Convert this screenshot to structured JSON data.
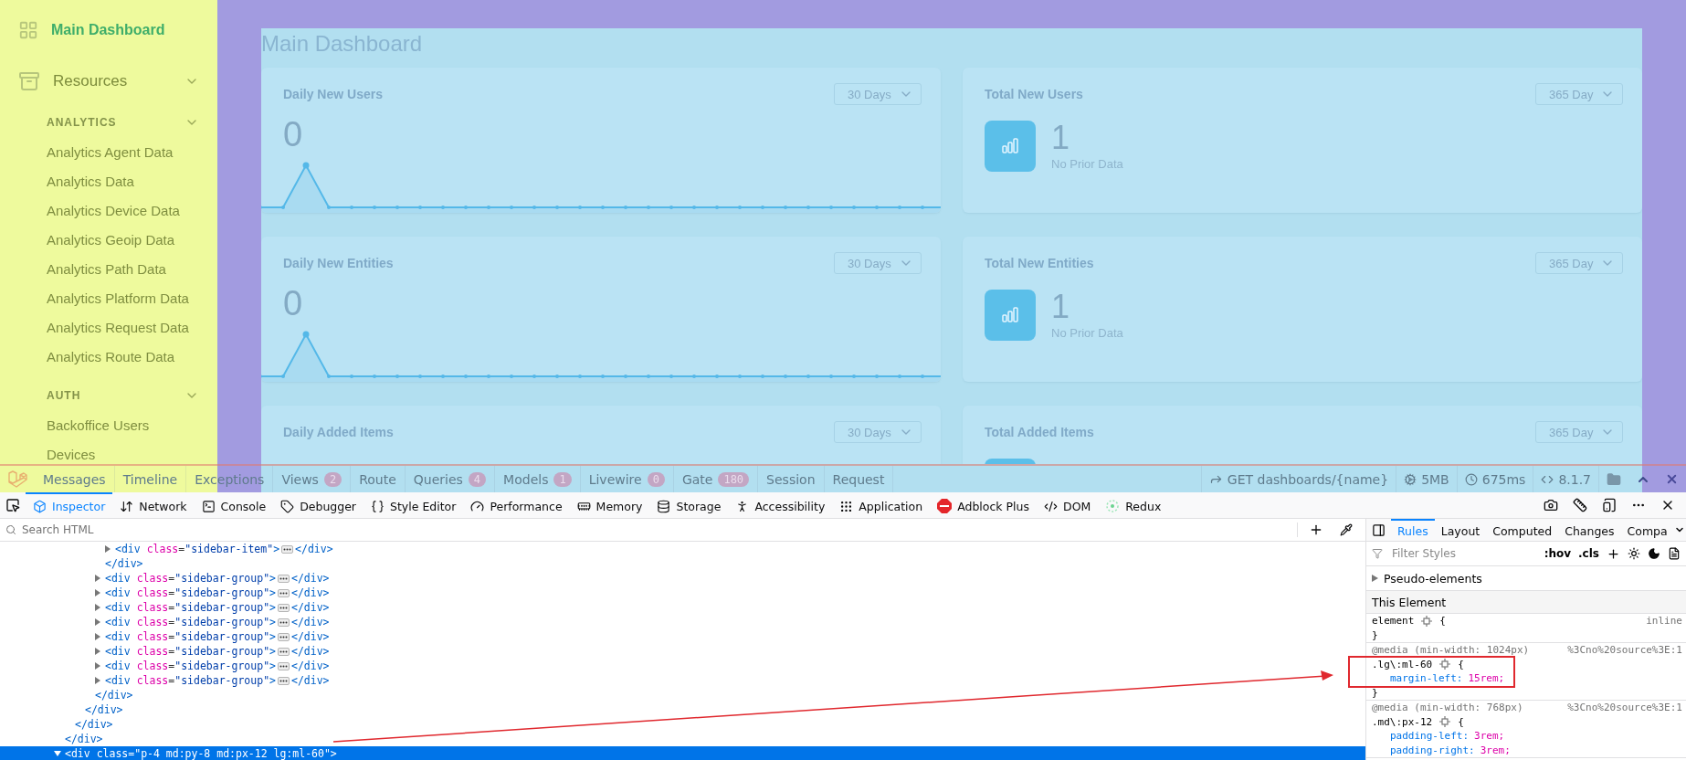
{
  "sidebar": {
    "items": [
      {
        "kind": "link",
        "label": "Main Dashboard",
        "selected": true
      },
      {
        "kind": "group",
        "label": "Resources",
        "expanded": true,
        "sections": [
          {
            "title": "ANALYTICS",
            "expanded": true,
            "items": [
              {
                "label": "Analytics Agent Data",
                "selected": false
              },
              {
                "label": "Analytics Data",
                "selected": false
              },
              {
                "label": "Analytics Device Data",
                "selected": false
              },
              {
                "label": "Analytics Geoip Data",
                "selected": false
              },
              {
                "label": "Analytics Path Data",
                "selected": false
              },
              {
                "label": "Analytics Platform Data",
                "selected": false
              },
              {
                "label": "Analytics Request Data",
                "selected": false
              },
              {
                "label": "Analytics Route Data",
                "selected": false
              }
            ]
          },
          {
            "title": "AUTH",
            "expanded": true,
            "items": [
              {
                "label": "Backoffice Users",
                "selected": false
              },
              {
                "label": "Devices",
                "selected": false
              }
            ]
          }
        ]
      }
    ]
  },
  "page_title": "Main Dashboard",
  "cards": [
    {
      "kind": "trend",
      "title": "Daily New Users",
      "range": "30 Days",
      "value": "0"
    },
    {
      "kind": "total",
      "title": "Total New Users",
      "range": "365 Day",
      "value": "1",
      "note": "No Prior Data"
    },
    {
      "kind": "trend",
      "title": "Daily New Entities",
      "range": "30 Days",
      "value": "0"
    },
    {
      "kind": "total",
      "title": "Total New Entities",
      "range": "365 Day",
      "value": "1",
      "note": "No Prior Data"
    },
    {
      "kind": "trend",
      "title": "Daily Added Items",
      "range": "30 Days"
    },
    {
      "kind": "total",
      "title": "Total Added Items",
      "range": "365 Day"
    }
  ],
  "debugbar": {
    "tabs": [
      {
        "label": "Messages"
      },
      {
        "label": "Timeline"
      },
      {
        "label": "Exceptions"
      },
      {
        "label": "Views",
        "count": "2"
      },
      {
        "label": "Route"
      },
      {
        "label": "Queries",
        "count": "4"
      },
      {
        "label": "Models",
        "count": "1"
      },
      {
        "label": "Livewire",
        "count": "0"
      },
      {
        "label": "Gate",
        "count": "180"
      },
      {
        "label": "Session"
      },
      {
        "label": "Request"
      }
    ],
    "request": "GET dashboards/{name}",
    "memory": "5MB",
    "duration": "675ms",
    "version": "8.1.7"
  },
  "devtools": {
    "tabs": [
      {
        "label": "Inspector",
        "selected": true
      },
      {
        "label": "Network",
        "selected": false
      },
      {
        "label": "Console",
        "selected": false
      },
      {
        "label": "Debugger",
        "selected": false
      },
      {
        "label": "Style Editor",
        "selected": false
      },
      {
        "label": "Performance",
        "selected": false
      },
      {
        "label": "Memory",
        "selected": false
      },
      {
        "label": "Storage",
        "selected": false
      },
      {
        "label": "Accessibility",
        "selected": false
      },
      {
        "label": "Application",
        "selected": false
      },
      {
        "label": "Adblock Plus",
        "selected": false
      },
      {
        "label": "DOM",
        "selected": false
      },
      {
        "label": "Redux",
        "selected": false
      }
    ],
    "search": {
      "placeholder": "Search HTML"
    },
    "html_tree": [
      {
        "close": "</div>",
        "children": [
          {
            "close": "</div>",
            "children": [
              {
                "close": "</div>",
                "children": [
                  {
                    "close": "</div>",
                    "children": [
                      {
                        "close": "</div>",
                        "children": [
                          {
                            "open": "<div class=\"sidebar-item\">",
                            "close": "</div>",
                            "expanded": false,
                            "selected": false
                          }
                        ]
                      },
                      {
                        "open": "<div class=\"sidebar-group\">",
                        "close": "</div>",
                        "expanded": false,
                        "selected": false
                      },
                      {
                        "open": "<div class=\"sidebar-group\">",
                        "close": "</div>",
                        "expanded": false,
                        "selected": false
                      },
                      {
                        "open": "<div class=\"sidebar-group\">",
                        "close": "</div>",
                        "expanded": false,
                        "selected": false
                      },
                      {
                        "open": "<div class=\"sidebar-group\">",
                        "close": "</div>",
                        "expanded": false,
                        "selected": false
                      },
                      {
                        "open": "<div class=\"sidebar-group\">",
                        "close": "</div>",
                        "expanded": false,
                        "selected": false
                      },
                      {
                        "open": "<div class=\"sidebar-group\">",
                        "close": "</div>",
                        "expanded": false,
                        "selected": false
                      },
                      {
                        "open": "<div class=\"sidebar-group\">",
                        "close": "</div>",
                        "expanded": false,
                        "selected": false
                      },
                      {
                        "open": "<div class=\"sidebar-group\">",
                        "close": "</div>",
                        "expanded": false,
                        "selected": false
                      }
                    ]
                  }
                ]
              }
            ]
          }
        ]
      },
      {
        "open": "<div class=\"p-4 md:py-8 md:px-12 lg:ml-60\">",
        "expanded": true,
        "selected": true
      }
    ],
    "side_tabs": [
      {
        "label": "Rules",
        "selected": true
      },
      {
        "label": "Layout",
        "selected": false
      },
      {
        "label": "Computed",
        "selected": false
      },
      {
        "label": "Changes",
        "selected": false
      },
      {
        "label": "Compa",
        "selected": false
      }
    ],
    "filter": {
      "placeholder": "Filter Styles",
      "hov": ":hov",
      "cls": ".cls"
    },
    "pseudo_elements": "Pseudo-elements",
    "this_element": "This Element",
    "rules": [
      {
        "selector": "element",
        "open": "{",
        "source": "inline",
        "close": "}"
      },
      {
        "media": "@media (min-width: 1024px)",
        "source": "%3Cno%20source%3E:1",
        "selector": ".lg\\:ml-60",
        "open": "{",
        "declarations": [
          {
            "property": "margin-left:",
            "value": "15rem;"
          }
        ],
        "close": "}",
        "highlighted": true
      },
      {
        "media": "@media (min-width: 768px)",
        "source": "%3Cno%20source%3E:1",
        "selector": ".md\\:px-12",
        "open": "{",
        "declarations": [
          {
            "property": "padding-left:",
            "value": "3rem;"
          },
          {
            "property": "padding-right:",
            "value": "3rem;"
          }
        ]
      }
    ]
  }
}
